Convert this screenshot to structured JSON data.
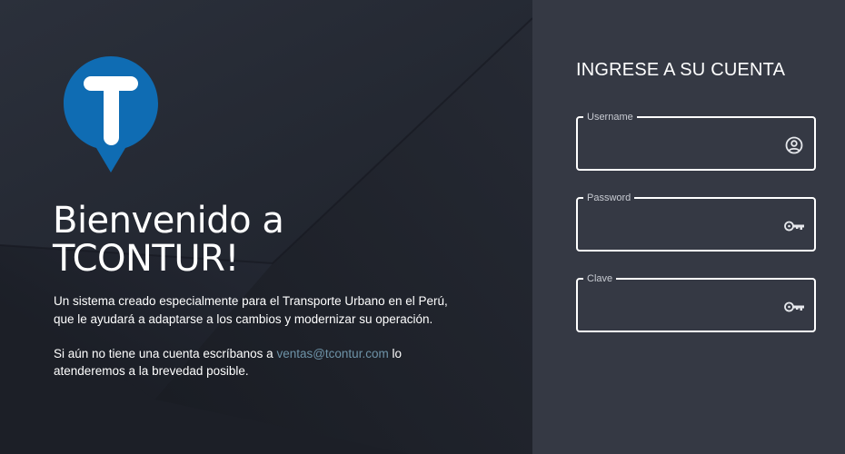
{
  "welcome": {
    "title_line1": "Bienvenido a",
    "title_line2": "TCONTUR!",
    "description_line1": "Un sistema creado especialmente para el Transporte Urbano en el Perú,",
    "description_line2": "que le ayudará a adaptarse a los cambios y modernizar su operación.",
    "contact_prefix": "Si aún no tiene una cuenta escríbanos a ",
    "contact_email": "ventas@tcontur.com",
    "contact_suffix": " lo",
    "contact_line2": "atenderemos a la brevedad posible."
  },
  "login": {
    "title": "INGRESE A SU CUENTA",
    "fields": [
      {
        "label": "Username",
        "value": "",
        "icon": "user-circle-icon"
      },
      {
        "label": "Password",
        "value": "",
        "icon": "key-icon"
      },
      {
        "label": "Clave",
        "value": "",
        "icon": "key-icon"
      }
    ]
  },
  "colors": {
    "left_bg": "#20242e",
    "right_bg": "#353944",
    "logo_blue": "#0f6cb3",
    "email_link": "#6e93a8"
  }
}
